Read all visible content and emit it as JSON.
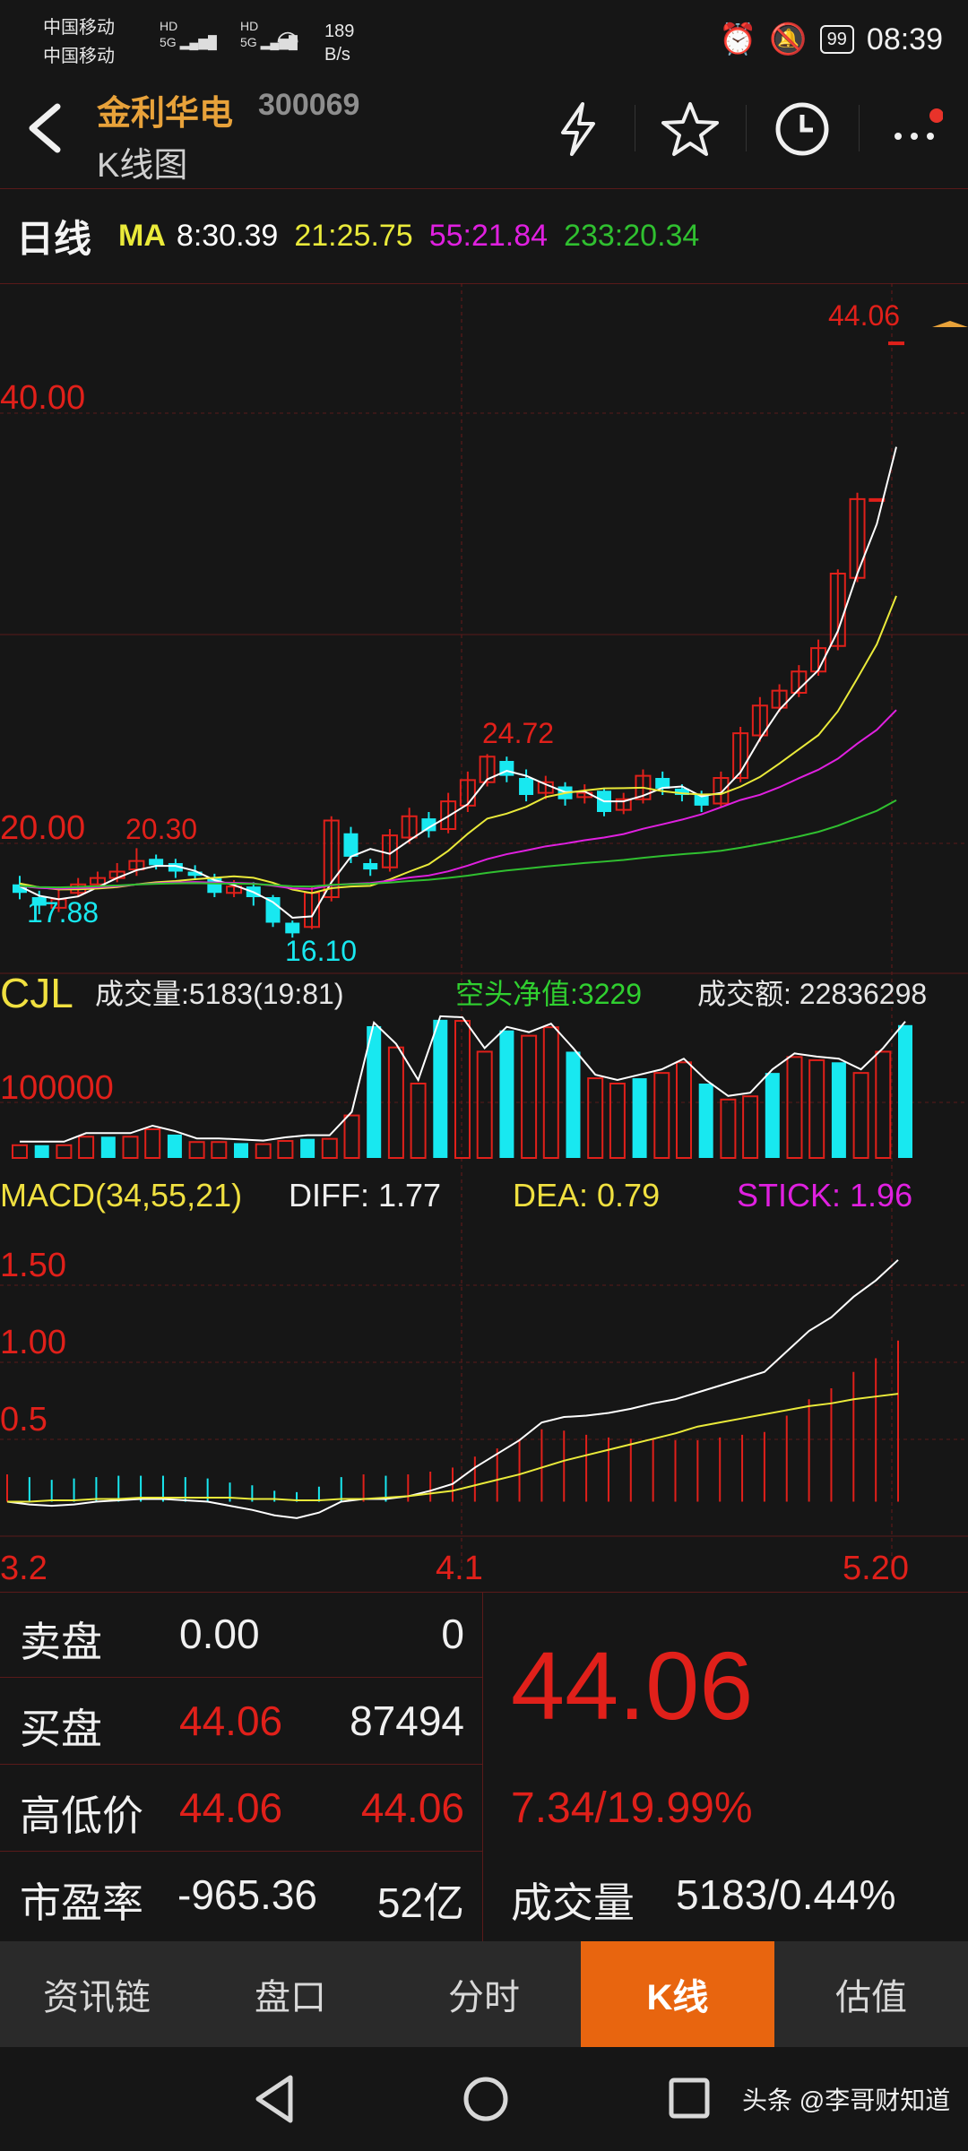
{
  "status_bar": {
    "carrier1": "中国移动",
    "carrier2": "中国移动",
    "net_speed": "189",
    "net_unit": "B/s",
    "battery": "99",
    "time": "08:39"
  },
  "header": {
    "stock_name": "金利华电",
    "stock_code": "300069",
    "subtitle": "K线图"
  },
  "ma_bar": {
    "period": "日线",
    "ma_label": "MA",
    "ma8": "8:30.39",
    "ma21": "21:25.75",
    "ma55": "55:21.84",
    "ma233": "233:20.34"
  },
  "kline": {
    "price_high_label": "44.06",
    "axis_40": "40.00",
    "axis_20": "20.00",
    "label_2030": "20.30",
    "label_1788": "17.88",
    "label_1610": "16.10",
    "label_2472": "24.72"
  },
  "volume": {
    "title": "CJL",
    "vol_text": "成交量:5183(19:81)",
    "net_text": "空头净值:3229",
    "amount_text": "成交额: 22836298",
    "axis_100000": "100000"
  },
  "macd": {
    "title": "MACD(34,55,21)",
    "diff": "DIFF: 1.77",
    "dea": "DEA: 0.79",
    "stick": "STICK: 1.96",
    "axis_150": "1.50",
    "axis_100": "1.00",
    "axis_05": "0.5"
  },
  "dates": {
    "d1": "3.2",
    "d2": "4.1",
    "d3": "5.20"
  },
  "quote": {
    "sell_label": "卖盘",
    "sell_price": "0.00",
    "sell_vol": "0",
    "buy_label": "买盘",
    "buy_price": "44.06",
    "buy_vol": "87494",
    "hl_label": "高低价",
    "high": "44.06",
    "low": "44.06",
    "pe_label": "市盈率",
    "pe": "-965.36",
    "mcap": "52亿",
    "price": "44.06",
    "change": "7.34/19.99%",
    "volume_label": "成交量",
    "volume_value": "5183/0.44%"
  },
  "tabs": [
    "资讯链",
    "盘口",
    "分时",
    "K线",
    "估值"
  ],
  "watermark": "头条 @李哥财知道",
  "colors": {
    "up": "#e0201a",
    "down": "#18e8f0",
    "ma8": "#ffffff",
    "ma21": "#eaea3a",
    "ma55": "#e020e0",
    "ma233": "#30c030",
    "accent": "#e8650f"
  },
  "chart_data": [
    {
      "type": "candlestick",
      "title": "日线",
      "ylim": [
        14,
        46
      ],
      "candles": [
        {
          "o": 18.6,
          "c": 18.2,
          "h": 19.0,
          "l": 17.9
        },
        {
          "o": 18.0,
          "c": 17.6,
          "h": 18.3,
          "l": 17.2
        },
        {
          "o": 17.5,
          "c": 17.9,
          "h": 18.5,
          "l": 17.3
        },
        {
          "o": 18.2,
          "c": 18.6,
          "h": 18.9,
          "l": 18.0
        },
        {
          "o": 18.6,
          "c": 18.9,
          "h": 19.2,
          "l": 18.4
        },
        {
          "o": 18.9,
          "c": 19.2,
          "h": 19.6,
          "l": 18.7
        },
        {
          "o": 19.3,
          "c": 19.7,
          "h": 20.3,
          "l": 19.0
        },
        {
          "o": 19.8,
          "c": 19.5,
          "h": 20.0,
          "l": 19.3
        },
        {
          "o": 19.6,
          "c": 19.2,
          "h": 19.8,
          "l": 18.9
        },
        {
          "o": 19.2,
          "c": 19.0,
          "h": 19.5,
          "l": 18.8
        },
        {
          "o": 18.9,
          "c": 18.2,
          "h": 19.1,
          "l": 18.0
        },
        {
          "o": 18.2,
          "c": 18.5,
          "h": 18.8,
          "l": 18.0
        },
        {
          "o": 18.5,
          "c": 18.0,
          "h": 18.7,
          "l": 17.6
        },
        {
          "o": 18.0,
          "c": 16.8,
          "h": 18.1,
          "l": 16.6
        },
        {
          "o": 16.8,
          "c": 16.3,
          "h": 16.9,
          "l": 16.1
        },
        {
          "o": 16.6,
          "c": 18.2,
          "h": 18.5,
          "l": 16.5
        },
        {
          "o": 18.0,
          "c": 21.6,
          "h": 21.8,
          "l": 17.8
        },
        {
          "o": 21.0,
          "c": 19.9,
          "h": 21.3,
          "l": 19.6
        },
        {
          "o": 19.6,
          "c": 19.3,
          "h": 19.8,
          "l": 19.0
        },
        {
          "o": 19.4,
          "c": 20.9,
          "h": 21.2,
          "l": 19.2
        },
        {
          "o": 20.8,
          "c": 21.8,
          "h": 22.2,
          "l": 20.5
        },
        {
          "o": 21.7,
          "c": 21.1,
          "h": 22.0,
          "l": 20.8
        },
        {
          "o": 21.2,
          "c": 22.5,
          "h": 22.9,
          "l": 21.0
        },
        {
          "o": 22.3,
          "c": 23.5,
          "h": 23.9,
          "l": 22.0
        },
        {
          "o": 23.4,
          "c": 24.6,
          "h": 24.72,
          "l": 23.2
        },
        {
          "o": 24.4,
          "c": 23.7,
          "h": 24.6,
          "l": 23.4
        },
        {
          "o": 23.6,
          "c": 22.8,
          "h": 24.0,
          "l": 22.5
        },
        {
          "o": 22.9,
          "c": 23.4,
          "h": 23.7,
          "l": 22.6
        },
        {
          "o": 23.2,
          "c": 22.6,
          "h": 23.4,
          "l": 22.3
        },
        {
          "o": 22.7,
          "c": 22.9,
          "h": 23.3,
          "l": 22.4
        },
        {
          "o": 23.0,
          "c": 22.0,
          "h": 23.1,
          "l": 21.8
        },
        {
          "o": 22.1,
          "c": 22.6,
          "h": 22.9,
          "l": 21.9
        },
        {
          "o": 22.6,
          "c": 23.7,
          "h": 24.0,
          "l": 22.4
        },
        {
          "o": 23.6,
          "c": 23.1,
          "h": 23.9,
          "l": 22.8
        },
        {
          "o": 23.1,
          "c": 22.8,
          "h": 23.3,
          "l": 22.5
        },
        {
          "o": 22.8,
          "c": 22.3,
          "h": 23.0,
          "l": 22.0
        },
        {
          "o": 22.4,
          "c": 23.6,
          "h": 23.9,
          "l": 22.2
        },
        {
          "o": 23.6,
          "c": 25.7,
          "h": 26.0,
          "l": 23.4
        },
        {
          "o": 25.6,
          "c": 27.0,
          "h": 27.4,
          "l": 25.3
        },
        {
          "o": 26.9,
          "c": 27.7,
          "h": 28.0,
          "l": 26.7
        },
        {
          "o": 27.6,
          "c": 28.6,
          "h": 28.9,
          "l": 27.4
        },
        {
          "o": 28.6,
          "c": 29.7,
          "h": 30.1,
          "l": 28.4
        },
        {
          "o": 29.8,
          "c": 33.2,
          "h": 33.4,
          "l": 29.6
        },
        {
          "o": 33.0,
          "c": 36.7,
          "h": 37.0,
          "l": 32.8
        },
        {
          "o": 36.7,
          "c": 36.7,
          "h": 36.7,
          "l": 36.7
        },
        {
          "o": 44.06,
          "c": 44.06,
          "h": 44.06,
          "l": 44.06
        }
      ]
    },
    {
      "type": "bar",
      "title": "CJL",
      "values": [
        12,
        12,
        12,
        20,
        20,
        20,
        27,
        22,
        15,
        15,
        14,
        13,
        16,
        18,
        18,
        40,
        124,
        104,
        70,
        130,
        129,
        100,
        120,
        115,
        123,
        100,
        75,
        70,
        75,
        80,
        90,
        70,
        55,
        58,
        80,
        95,
        92,
        90,
        80,
        100,
        125
      ],
      "ylim": [
        0,
        140
      ]
    },
    {
      "type": "line",
      "title": "MACD(34,55,21)",
      "series": [
        {
          "name": "DIFF",
          "values": [
            0.0,
            -0.02,
            -0.03,
            -0.02,
            0.0,
            0.01,
            0.02,
            0.02,
            0.01,
            0.0,
            -0.03,
            -0.06,
            -0.1,
            -0.12,
            -0.08,
            0.0,
            0.02,
            0.02,
            0.04,
            0.08,
            0.13,
            0.25,
            0.35,
            0.45,
            0.58,
            0.62,
            0.63,
            0.65,
            0.68,
            0.72,
            0.75,
            0.8,
            0.85,
            0.9,
            0.95,
            1.1,
            1.25,
            1.35,
            1.5,
            1.62,
            1.77
          ]
        },
        {
          "name": "DEA",
          "values": [
            0.0,
            0.0,
            0.01,
            0.01,
            0.02,
            0.02,
            0.03,
            0.03,
            0.03,
            0.03,
            0.03,
            0.02,
            0.02,
            0.01,
            0.01,
            0.02,
            0.02,
            0.03,
            0.04,
            0.06,
            0.08,
            0.12,
            0.16,
            0.2,
            0.25,
            0.3,
            0.34,
            0.38,
            0.42,
            0.46,
            0.5,
            0.55,
            0.58,
            0.61,
            0.64,
            0.67,
            0.7,
            0.72,
            0.75,
            0.77,
            0.79
          ]
        }
      ],
      "ylim": [
        -0.2,
        1.9
      ]
    }
  ]
}
